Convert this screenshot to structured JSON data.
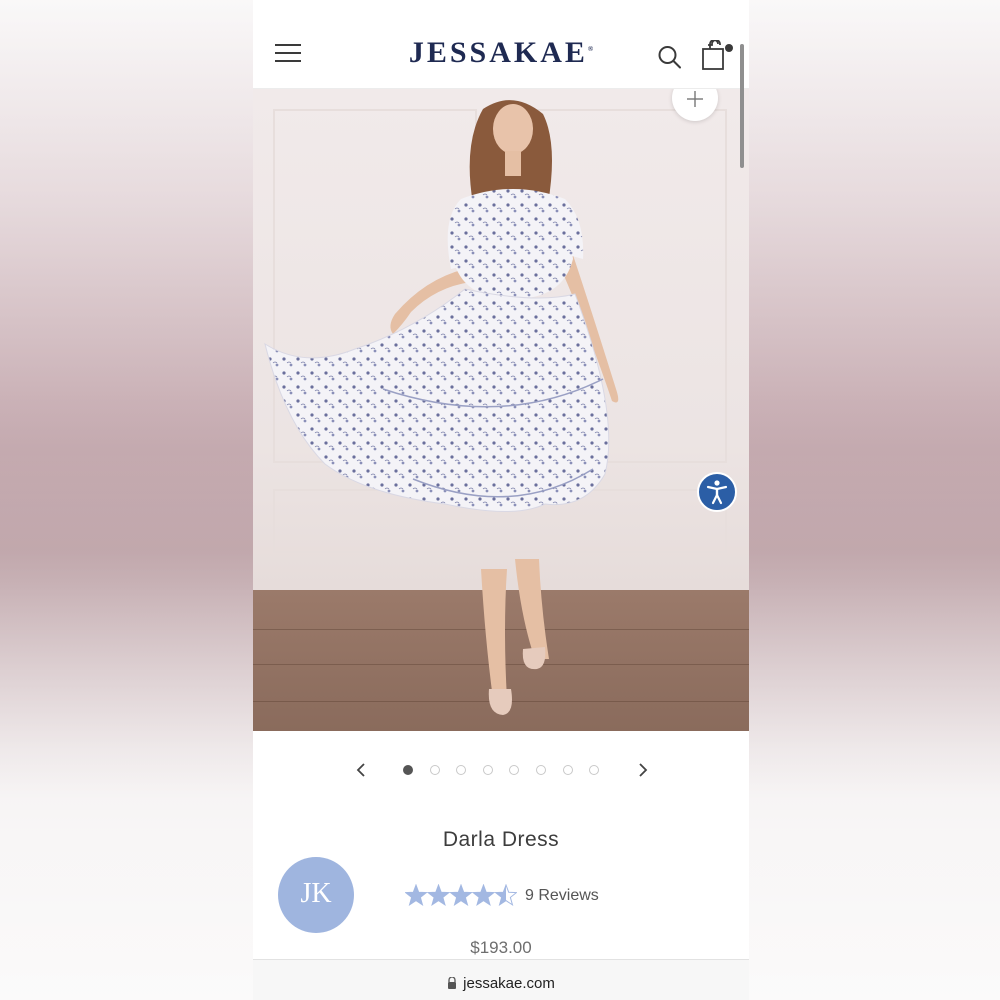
{
  "header": {
    "brand": "JESSAKAE",
    "brand_mark": "®"
  },
  "product": {
    "title": "Darla Dress",
    "rating": 4.5,
    "rating_max": 5,
    "reviews_label": "9 Reviews",
    "price": "$193.00"
  },
  "gallery": {
    "image_count": 8,
    "active_index": 0
  },
  "avatar": {
    "initials": "JK"
  },
  "browser": {
    "url": "jessakae.com"
  },
  "colors": {
    "brand": "#1f2a52",
    "star": "#a3b8e2",
    "accessibility": "#2b5ea6"
  }
}
